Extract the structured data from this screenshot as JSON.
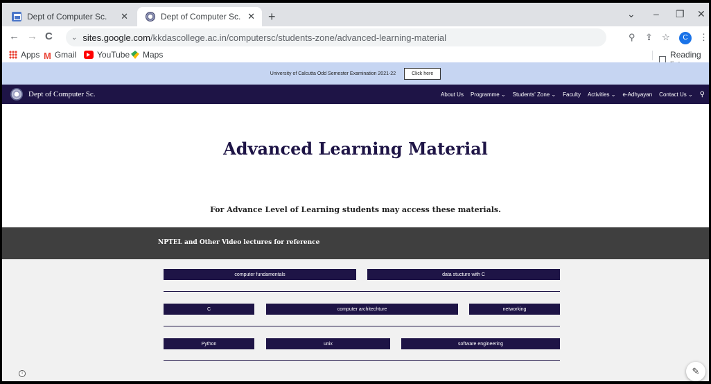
{
  "browser": {
    "tabs": [
      {
        "title": "Dept of Computer Sc.",
        "close": "✕"
      },
      {
        "title": "Dept of Computer Sc. - Advance",
        "close": "✕"
      }
    ],
    "new_tab": "+",
    "window_controls": {
      "dropdown": "⌄",
      "minimize": "–",
      "restore": "❐",
      "close": "✕"
    },
    "nav": {
      "back": "←",
      "forward": "→",
      "reload": "C"
    },
    "address": {
      "host": "sites.google.com",
      "path": "/kkdascollege.ac.in/computersc/students-zone/advanced-learning-material"
    },
    "profile_initial": "C",
    "bookmarks": [
      {
        "label": "Apps"
      },
      {
        "label": "Gmail"
      },
      {
        "label": "YouTube"
      },
      {
        "label": "Maps"
      }
    ],
    "reading_list": "Reading list"
  },
  "page": {
    "announcement": {
      "text": "University of Calcutta Odd Semester Examination 2021-22",
      "button": "Click here"
    },
    "site_name": "Dept of Computer Sc.",
    "menu": [
      "About Us",
      "Programme ⌄",
      "Students' Zone ⌄",
      "Faculty",
      "Activities ⌄",
      "e-Adhyayan",
      "Contact Us ⌄"
    ],
    "heading": "Advanced Learning Material",
    "subline": "For Advance Level of Learning students may access these materials.",
    "band_text": "NPTEL and Other Video lectures for reference",
    "buttons": {
      "row1": [
        "computer fundamentals",
        "data stucture with C"
      ],
      "row2": [
        "C",
        "computer architechture",
        "networking"
      ],
      "row3": [
        "Python",
        "unix",
        "software engineering"
      ]
    }
  }
}
